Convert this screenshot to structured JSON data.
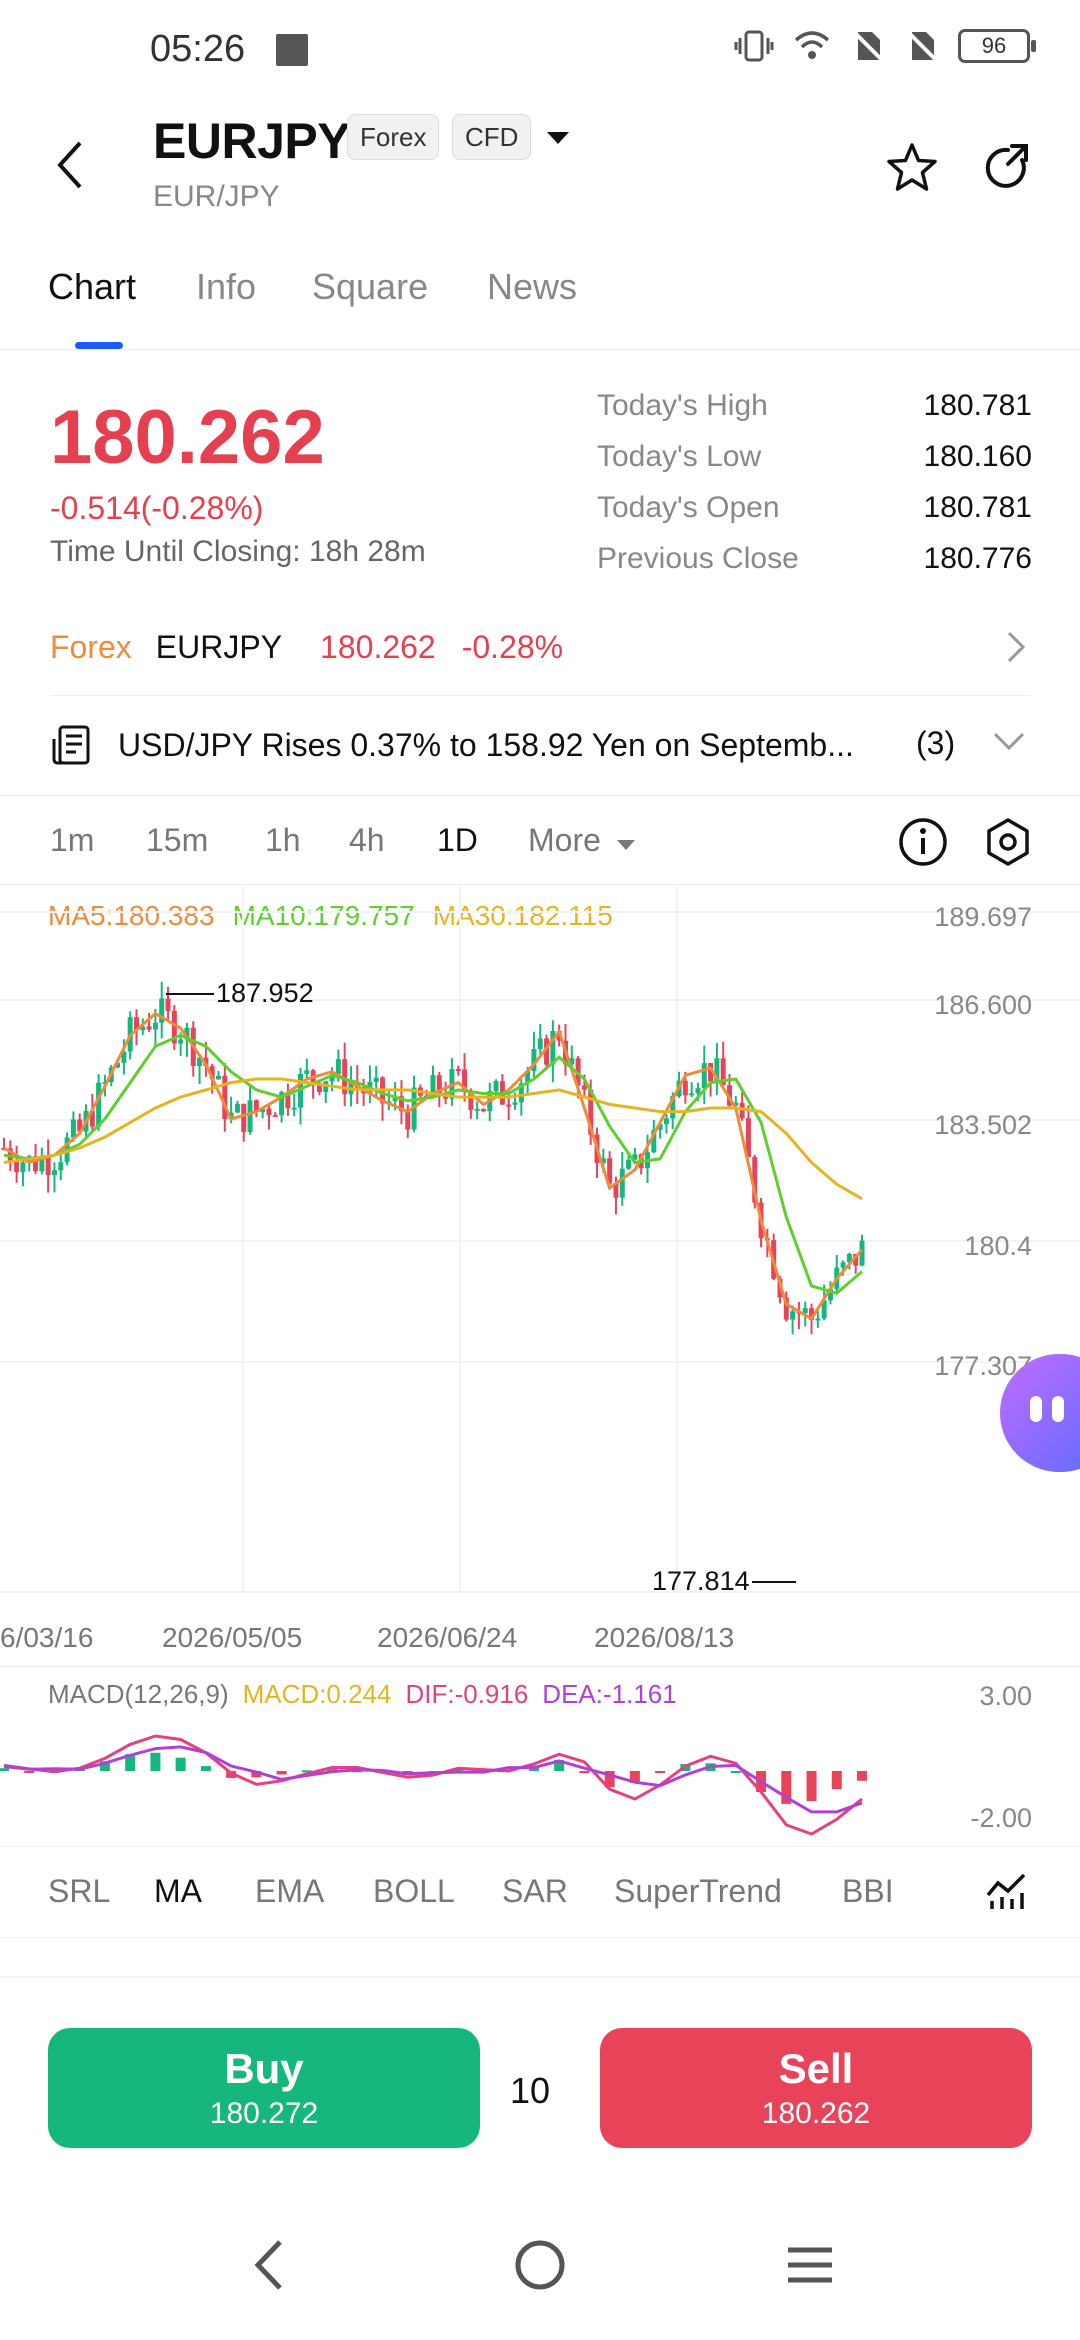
{
  "status_bar": {
    "time": "05:26",
    "battery": "96"
  },
  "header": {
    "symbol": "EURJPY",
    "tags": [
      "Forex",
      "CFD"
    ],
    "subtitle": "EUR/JPY"
  },
  "tabs": [
    {
      "label": "Chart",
      "active": true
    },
    {
      "label": "Info",
      "active": false
    },
    {
      "label": "Square",
      "active": false
    },
    {
      "label": "News",
      "active": false
    }
  ],
  "quote": {
    "price": "180.262",
    "change": "-0.514(-0.28%)",
    "closing_label": "Time Until Closing:",
    "closing_value": "18h 28m",
    "stats": [
      {
        "label": "Today's High",
        "value": "180.781"
      },
      {
        "label": "Today's Low",
        "value": "180.160"
      },
      {
        "label": "Today's Open",
        "value": "180.781"
      },
      {
        "label": "Previous Close",
        "value": "180.776"
      }
    ]
  },
  "forex_row": {
    "label": "Forex",
    "symbol": "EURJPY",
    "price": "180.262",
    "change": "-0.28%"
  },
  "news_row": {
    "headline": "USD/JPY Rises 0.37% to 158.92 Yen on Septemb...",
    "count": "(3)"
  },
  "timeframes": [
    "1m",
    "15m",
    "1h",
    "4h",
    "1D",
    "More"
  ],
  "active_timeframe": "1D",
  "chart_data": {
    "type": "candlestick",
    "ma_legend": {
      "ma5": "MA5:180.383",
      "ma10": "MA10:179.757",
      "ma30": "MA30:182.115"
    },
    "y_ticks": [
      "189.697",
      "186.600",
      "183.502",
      "180.4",
      "177.307"
    ],
    "x_ticks": [
      "6/03/16",
      "2026/05/05",
      "2026/06/24",
      "2026/08/13"
    ],
    "high_annotation": "187.952",
    "low_annotation": "177.814",
    "ylim": [
      177.307,
      189.697
    ],
    "series": [
      {
        "name": "MA5",
        "color": "#f08a3c",
        "values": [
          183.2,
          182.8,
          183.0,
          183.6,
          184.9,
          186.3,
          186.9,
          186.5,
          185.5,
          184.0,
          184.2,
          184.6,
          185.1,
          185.3,
          184.9,
          184.5,
          184.2,
          184.7,
          185.0,
          184.4,
          184.8,
          185.5,
          186.4,
          184.3,
          182.1,
          182.6,
          183.9,
          185.2,
          185.4,
          184.3,
          181.2,
          178.9,
          178.5,
          179.6,
          180.4
        ]
      },
      {
        "name": "MA10",
        "color": "#5fcf2f",
        "values": [
          183.0,
          182.9,
          183.0,
          183.3,
          184.0,
          185.0,
          186.0,
          186.3,
          186.0,
          185.3,
          184.8,
          184.6,
          184.9,
          185.2,
          185.0,
          184.7,
          184.5,
          184.6,
          184.8,
          184.7,
          184.7,
          185.1,
          185.7,
          185.1,
          183.8,
          182.8,
          182.9,
          184.2,
          185.0,
          185.1,
          183.9,
          181.3,
          179.4,
          179.2,
          179.8
        ]
      },
      {
        "name": "MA30",
        "color": "#e6b421",
        "values": [
          182.8,
          182.9,
          183.0,
          183.2,
          183.5,
          183.9,
          184.3,
          184.6,
          184.8,
          185.0,
          185.1,
          185.1,
          185.0,
          184.9,
          184.8,
          184.8,
          184.8,
          184.7,
          184.6,
          184.6,
          184.6,
          184.7,
          184.8,
          184.6,
          184.4,
          184.3,
          184.2,
          184.2,
          184.3,
          184.3,
          184.2,
          183.6,
          182.8,
          182.2,
          181.8
        ]
      }
    ]
  },
  "macd": {
    "title": "MACD(12,26,9)",
    "macd": "MACD:0.244",
    "dif": "DIF:-0.916",
    "dea": "DEA:-1.161",
    "y_top": "3.00",
    "y_bottom": "-2.00"
  },
  "indicators": [
    {
      "label": "SRL",
      "active": false
    },
    {
      "label": "MA",
      "active": true
    },
    {
      "label": "EMA",
      "active": false
    },
    {
      "label": "BOLL",
      "active": false
    },
    {
      "label": "SAR",
      "active": false
    },
    {
      "label": "SuperTrend",
      "active": false
    },
    {
      "label": "BBI",
      "active": false
    }
  ],
  "trade": {
    "buy_label": "Buy",
    "buy_price": "180.272",
    "quantity": "10",
    "sell_label": "Sell",
    "sell_price": "180.262"
  },
  "colors": {
    "up": "#16b77c",
    "down": "#e9435a",
    "accent": "#1a5bf5"
  }
}
